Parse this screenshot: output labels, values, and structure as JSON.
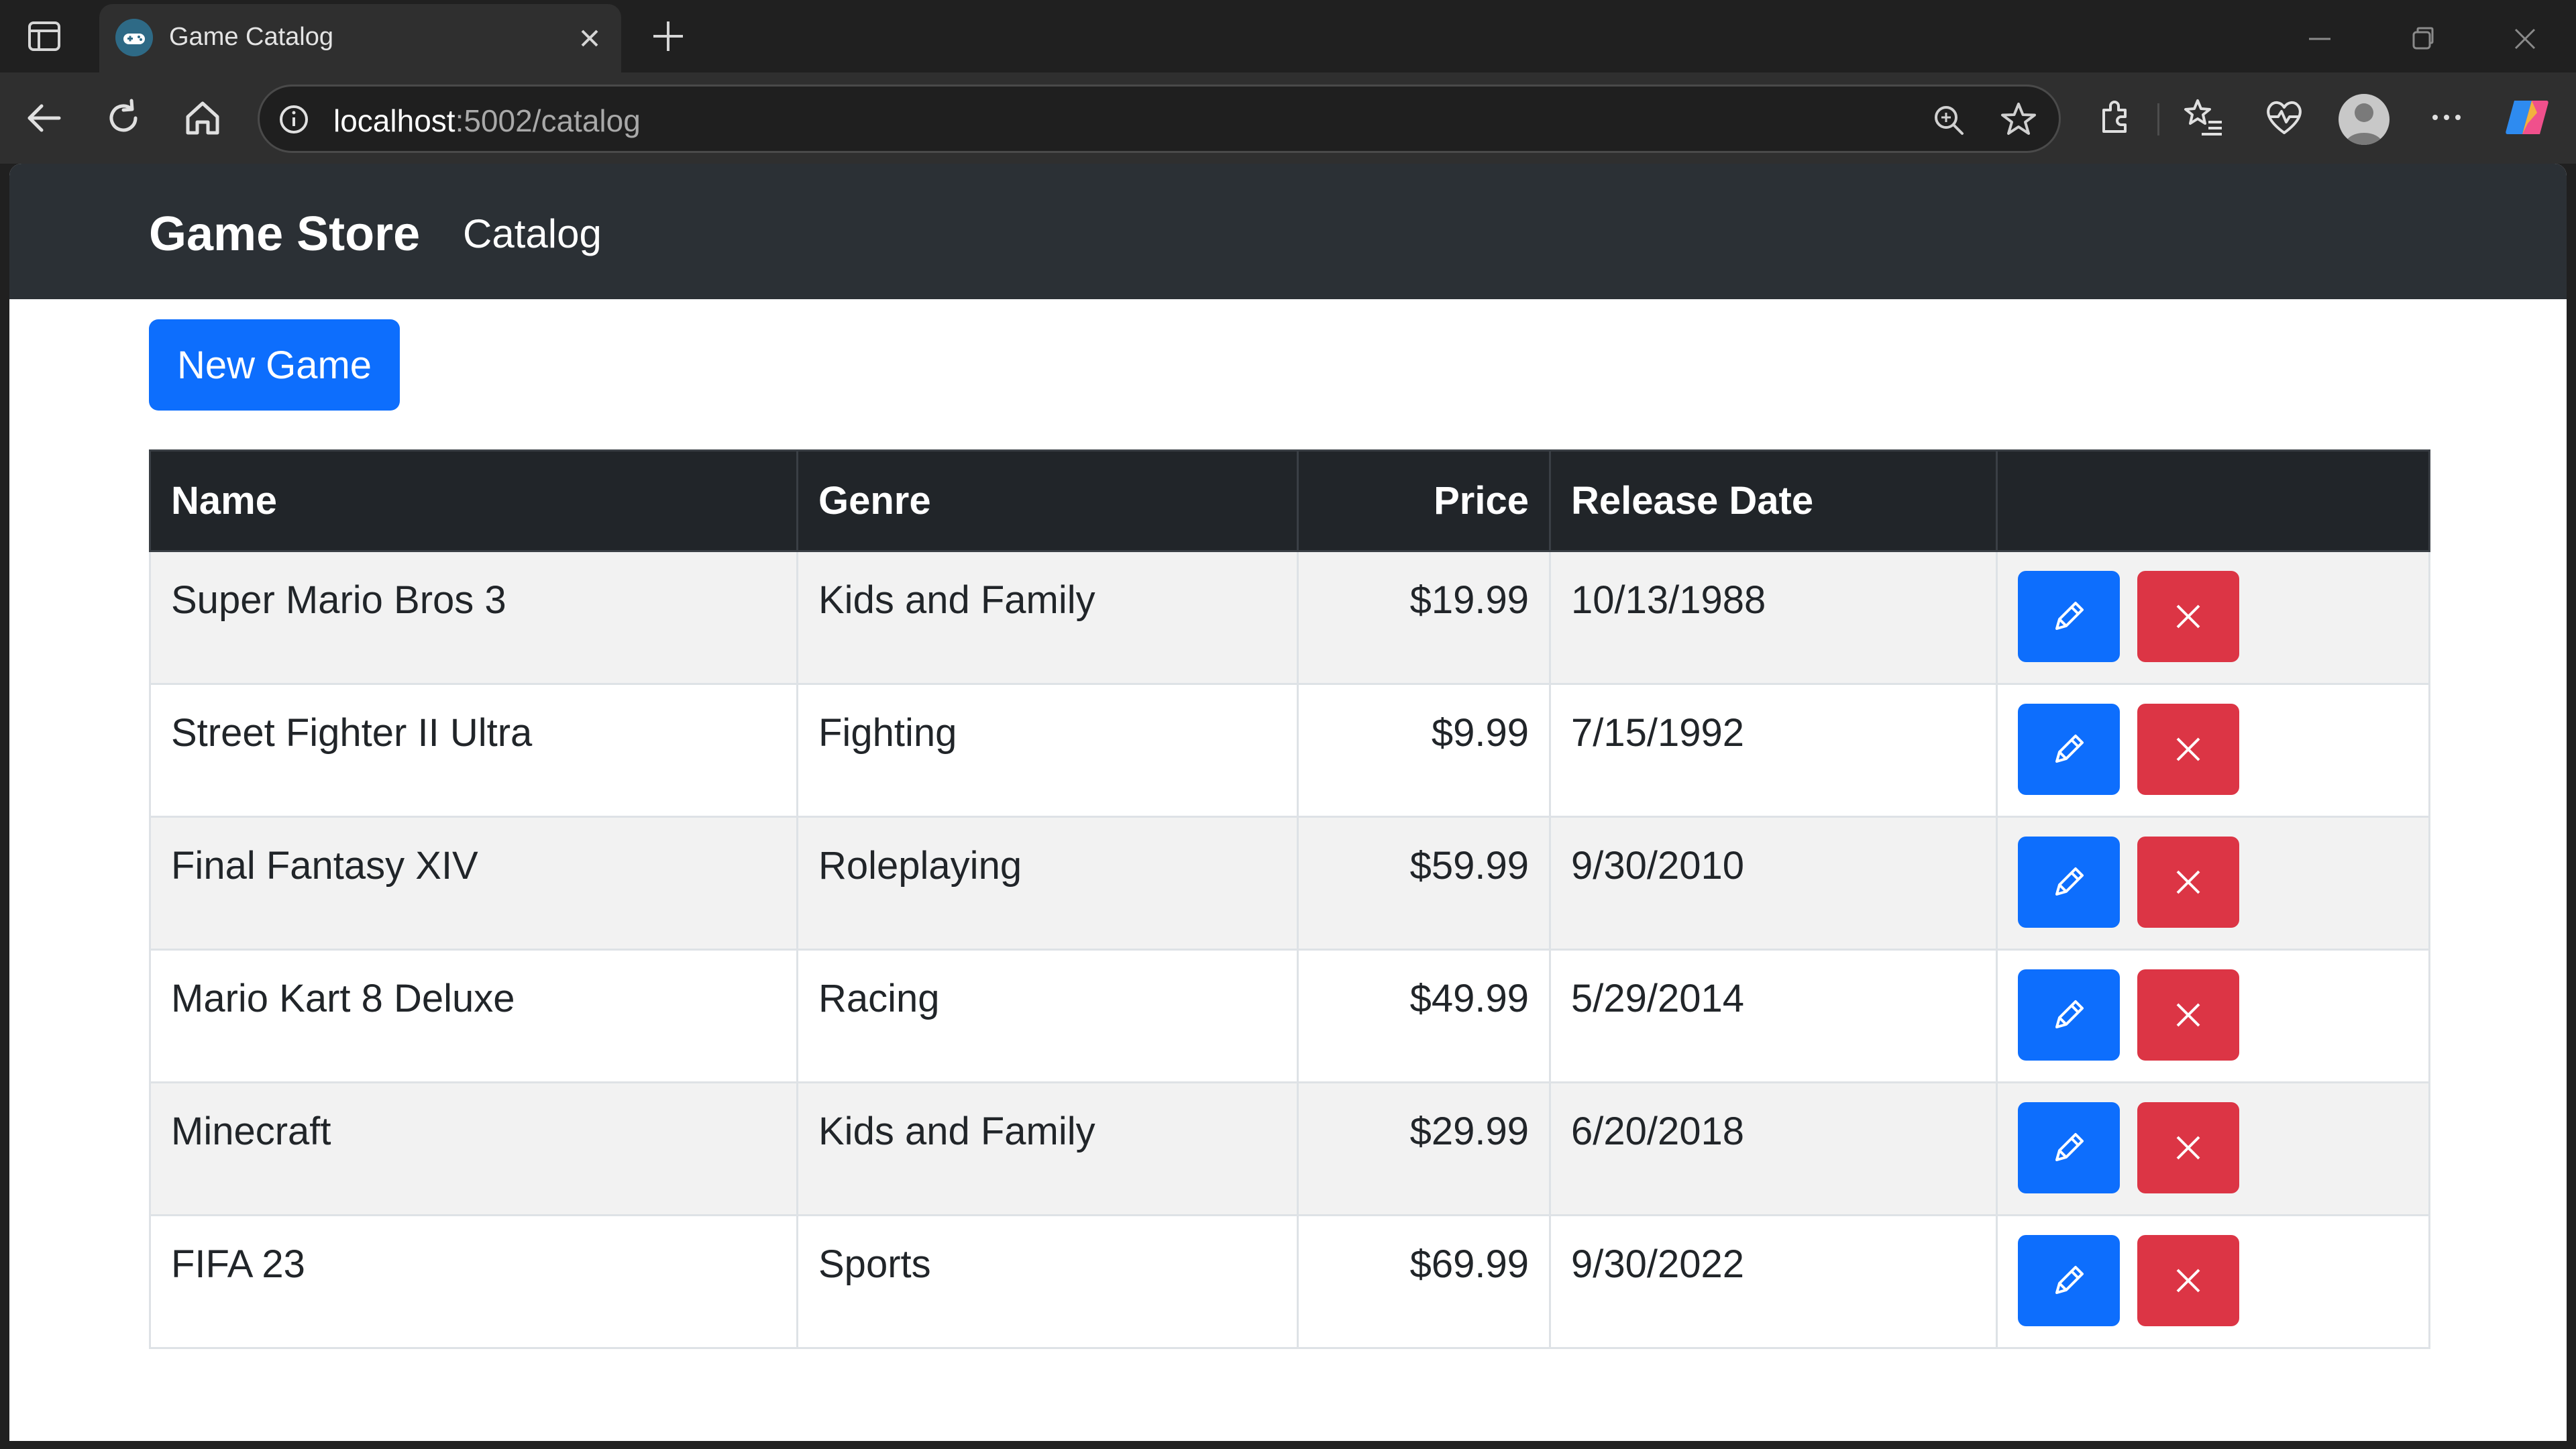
{
  "browser": {
    "tab": {
      "title": "Game Catalog",
      "favicon": "game-controller-icon"
    },
    "address": {
      "host": "localhost",
      "path": ":5002/catalog"
    }
  },
  "page": {
    "navbar": {
      "brand": "Game Store",
      "links": [
        {
          "label": "Catalog"
        }
      ]
    },
    "new_game_label": "New Game",
    "table": {
      "headers": {
        "name": "Name",
        "genre": "Genre",
        "price": "Price",
        "release_date": "Release Date",
        "actions": ""
      },
      "rows": [
        {
          "name": "Super Mario Bros 3",
          "genre": "Kids and Family",
          "price": "$19.99",
          "release_date": "10/13/1988"
        },
        {
          "name": "Street Fighter II Ultra",
          "genre": "Fighting",
          "price": "$9.99",
          "release_date": "7/15/1992"
        },
        {
          "name": "Final Fantasy XIV",
          "genre": "Roleplaying",
          "price": "$59.99",
          "release_date": "9/30/2010"
        },
        {
          "name": "Mario Kart 8 Deluxe",
          "genre": "Racing",
          "price": "$49.99",
          "release_date": "5/29/2014"
        },
        {
          "name": "Minecraft",
          "genre": "Kids and Family",
          "price": "$29.99",
          "release_date": "6/20/2018"
        },
        {
          "name": "FIFA 23",
          "genre": "Sports",
          "price": "$69.99",
          "release_date": "9/30/2022"
        }
      ],
      "row_actions": {
        "edit_icon": "pencil-icon",
        "delete_icon": "x-icon"
      }
    }
  },
  "colors": {
    "primary": "#0d6efd",
    "danger": "#dc3545",
    "navbar": "#2b3035",
    "table_header": "#212529",
    "stripe": "#f2f2f2"
  }
}
